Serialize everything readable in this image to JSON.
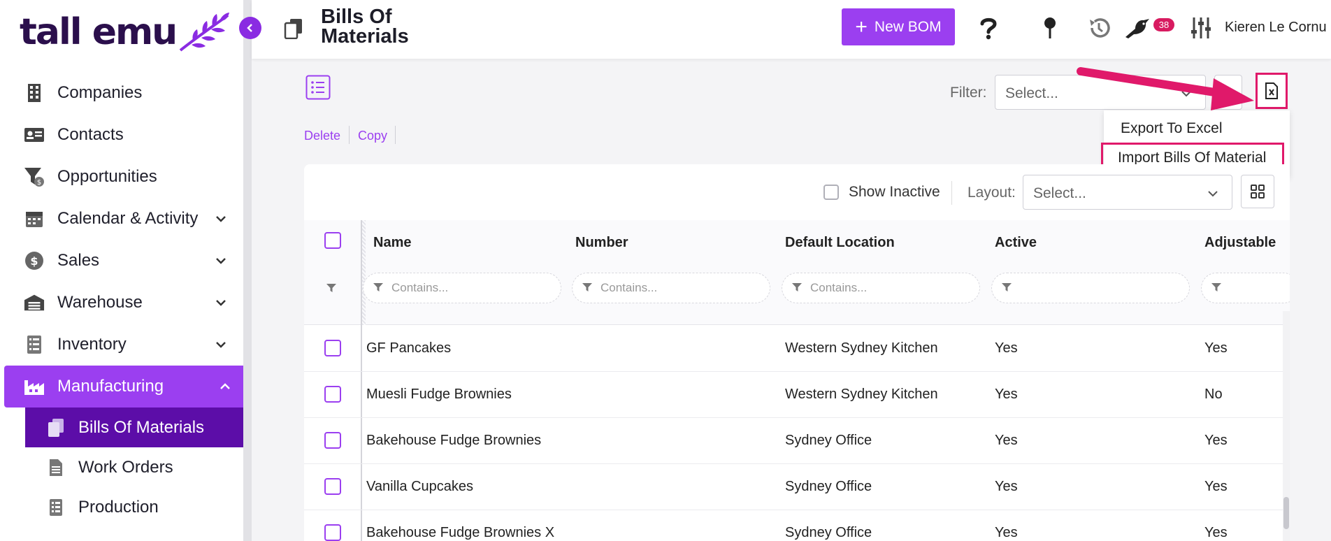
{
  "brand": {
    "logo_text": "tall emu",
    "accent": "#9b3ff0",
    "dark": "#2b0f4c",
    "highlight": "#e0196a"
  },
  "sidebar": {
    "items": [
      {
        "label": "Companies",
        "icon": "building-icon"
      },
      {
        "label": "Contacts",
        "icon": "contact-card-icon"
      },
      {
        "label": "Opportunities",
        "icon": "funnel-icon"
      },
      {
        "label": "Calendar & Activity",
        "icon": "calendar-icon",
        "expandable": true
      },
      {
        "label": "Sales",
        "icon": "dollar-icon",
        "expandable": true
      },
      {
        "label": "Warehouse",
        "icon": "warehouse-icon",
        "expandable": true
      },
      {
        "label": "Inventory",
        "icon": "list-icon",
        "expandable": true
      },
      {
        "label": "Manufacturing",
        "icon": "factory-icon",
        "expandable": true,
        "active": true
      }
    ],
    "sub_items": [
      {
        "label": "Bills Of Materials",
        "active": true
      },
      {
        "label": "Work Orders"
      },
      {
        "label": "Production"
      }
    ]
  },
  "header": {
    "title": "Bills Of Materials",
    "new_button": "New BOM",
    "notification_count": "38",
    "user_name": "Kieren Le Cornu"
  },
  "toolbar": {
    "filter_label": "Filter:",
    "filter_placeholder": "Select...",
    "actions": [
      "Delete",
      "Copy"
    ],
    "export_menu": [
      "Export To Excel",
      "Import Bills Of Material"
    ]
  },
  "grid": {
    "show_inactive": "Show Inactive",
    "layout_label": "Layout:",
    "layout_placeholder": "Select...",
    "columns": [
      "Name",
      "Number",
      "Default Location",
      "Active",
      "Adjustable"
    ],
    "filter_placeholder": "Contains...",
    "rows": [
      {
        "name": "GF Pancakes",
        "number": "",
        "location": "Western Sydney Kitchen",
        "active": "Yes",
        "adjustable": "Yes"
      },
      {
        "name": "Muesli Fudge Brownies",
        "number": "",
        "location": "Western Sydney Kitchen",
        "active": "Yes",
        "adjustable": "No"
      },
      {
        "name": "Bakehouse Fudge Brownies",
        "number": "",
        "location": "Sydney Office",
        "active": "Yes",
        "adjustable": "Yes"
      },
      {
        "name": "Vanilla Cupcakes",
        "number": "",
        "location": "Sydney Office",
        "active": "Yes",
        "adjustable": "Yes"
      },
      {
        "name": "Bakehouse Fudge Brownies X",
        "number": "",
        "location": "Sydney Office",
        "active": "Yes",
        "adjustable": "Yes"
      }
    ]
  }
}
